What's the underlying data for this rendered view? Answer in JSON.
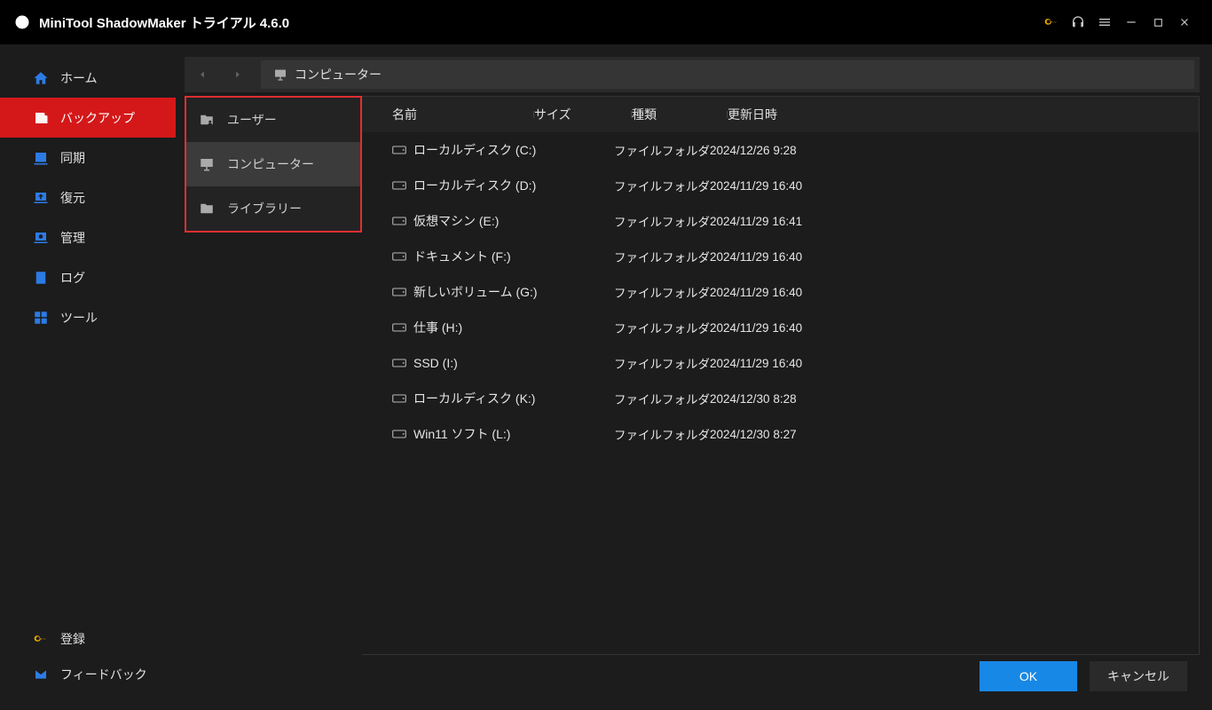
{
  "title": "MiniTool ShadowMaker トライアル 4.6.0",
  "sidebar": {
    "items": [
      {
        "label": "ホーム"
      },
      {
        "label": "バックアップ"
      },
      {
        "label": "同期"
      },
      {
        "label": "復元"
      },
      {
        "label": "管理"
      },
      {
        "label": "ログ"
      },
      {
        "label": "ツール"
      }
    ],
    "register": "登録",
    "feedback": "フィードバック"
  },
  "breadcrumb": "コンピューター",
  "tree": [
    {
      "label": "ユーザー"
    },
    {
      "label": "コンピューター"
    },
    {
      "label": "ライブラリー"
    }
  ],
  "columns": {
    "name": "名前",
    "size": "サイズ",
    "type": "種類",
    "date": "更新日時"
  },
  "rows": [
    {
      "name": "ローカルディスク (C:)",
      "type": "ファイルフォルダ",
      "date": "2024/12/26 9:28"
    },
    {
      "name": "ローカルディスク (D:)",
      "type": "ファイルフォルダ",
      "date": "2024/11/29 16:40"
    },
    {
      "name": "仮想マシン (E:)",
      "type": "ファイルフォルダ",
      "date": "2024/11/29 16:41"
    },
    {
      "name": "ドキュメント (F:)",
      "type": "ファイルフォルダ",
      "date": "2024/11/29 16:40"
    },
    {
      "name": "新しいボリューム (G:)",
      "type": "ファイルフォルダ",
      "date": "2024/11/29 16:40"
    },
    {
      "name": "仕事 (H:)",
      "type": "ファイルフォルダ",
      "date": "2024/11/29 16:40"
    },
    {
      "name": "SSD (I:)",
      "type": "ファイルフォルダ",
      "date": "2024/11/29 16:40"
    },
    {
      "name": "ローカルディスク (K:)",
      "type": "ファイルフォルダ",
      "date": "2024/12/30 8:28"
    },
    {
      "name": "Win11 ソフト (L:)",
      "type": "ファイルフォルダ",
      "date": "2024/12/30 8:27"
    }
  ],
  "footer": {
    "ok": "OK",
    "cancel": "キャンセル"
  }
}
